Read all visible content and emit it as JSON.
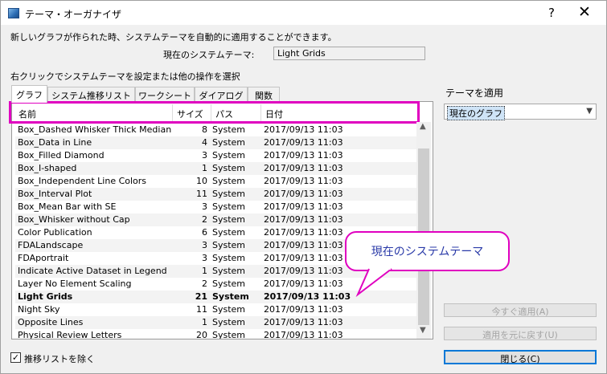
{
  "window": {
    "title": "テーマ・オーガナイザ",
    "help": "?",
    "close": "✕"
  },
  "description": "新しいグラフが作られた時、システムテーマを自動的に適用することができます。",
  "current_theme": {
    "label": "現在のシステムテーマ:",
    "value": "Light Grids"
  },
  "instruction": "右クリックでシステムテーマを設定または他の操作を選択",
  "tabs": [
    "グラフ",
    "システム推移リスト",
    "ワークシート",
    "ダイアログ",
    "関数"
  ],
  "columns": [
    "名前",
    "サイズ",
    "パス",
    "日付"
  ],
  "rows": [
    {
      "name": "Box_Dashed Whisker Thick Median",
      "size": "8",
      "path": "System",
      "date": "2017/09/13 11:03"
    },
    {
      "name": "Box_Data in Line",
      "size": "4",
      "path": "System",
      "date": "2017/09/13 11:03"
    },
    {
      "name": "Box_Filled Diamond",
      "size": "3",
      "path": "System",
      "date": "2017/09/13 11:03"
    },
    {
      "name": "Box_I-shaped",
      "size": "1",
      "path": "System",
      "date": "2017/09/13 11:03"
    },
    {
      "name": "Box_Independent Line Colors",
      "size": "10",
      "path": "System",
      "date": "2017/09/13 11:03"
    },
    {
      "name": "Box_Interval Plot",
      "size": "11",
      "path": "System",
      "date": "2017/09/13 11:03"
    },
    {
      "name": "Box_Mean Bar with SE",
      "size": "3",
      "path": "System",
      "date": "2017/09/13 11:03"
    },
    {
      "name": "Box_Whisker without Cap",
      "size": "2",
      "path": "System",
      "date": "2017/09/13 11:03"
    },
    {
      "name": "Color Publication",
      "size": "6",
      "path": "System",
      "date": "2017/09/13 11:03"
    },
    {
      "name": "FDALandscape",
      "size": "3",
      "path": "System",
      "date": "2017/09/13 11:03"
    },
    {
      "name": "FDAportrait",
      "size": "3",
      "path": "System",
      "date": "2017/09/13 11:03"
    },
    {
      "name": "Indicate Active Dataset in Legend",
      "size": "1",
      "path": "System",
      "date": "2017/09/13 11:03"
    },
    {
      "name": "Layer No Element Scaling",
      "size": "2",
      "path": "System",
      "date": "2017/09/13 11:03"
    },
    {
      "name": "Light Grids",
      "size": "21",
      "path": "System",
      "date": "2017/09/13 11:03",
      "bold": true
    },
    {
      "name": "Night Sky",
      "size": "11",
      "path": "System",
      "date": "2017/09/13 11:03"
    },
    {
      "name": "Opposite Lines",
      "size": "1",
      "path": "System",
      "date": "2017/09/13 11:03"
    },
    {
      "name": "Physical Review Letters",
      "size": "20",
      "path": "System",
      "date": "2017/09/13 11:03"
    }
  ],
  "callout": "現在のシステムテーマ",
  "apply": {
    "label": "テーマを適用",
    "selected": "現在のグラフ"
  },
  "buttons": {
    "apply_now": "今すぐ適用(A)",
    "revert": "適用を元に戻す(U)",
    "close": "閉じる(C)"
  },
  "exclude_checkbox": {
    "label": "推移リストを除く",
    "checked": true
  },
  "colors": {
    "highlight": "#e000c0",
    "callout_text": "#2a3aa8",
    "default_button_border": "#0078d7"
  }
}
